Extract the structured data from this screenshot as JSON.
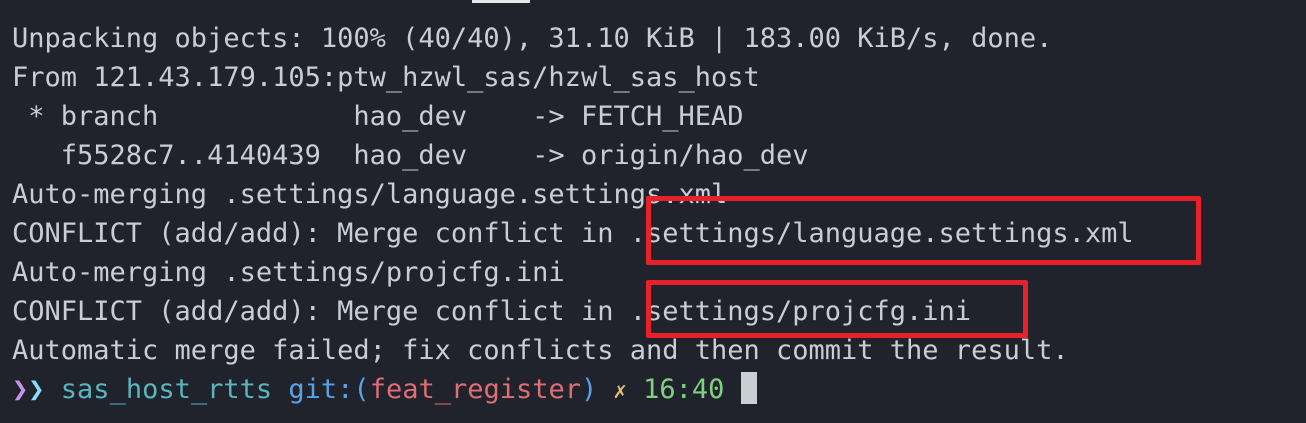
{
  "terminal": {
    "lines": [
      "Unpacking objects: 100% (40/40), 31.10 KiB | 183.00 KiB/s, done.",
      "From 121.43.179.105:ptw_hzwl_sas/hzwl_sas_host",
      " * branch            hao_dev    -> FETCH_HEAD",
      "   f5528c7..4140439  hao_dev    -> origin/hao_dev",
      "Auto-merging .settings/language.settings.xml",
      "CONFLICT (add/add): Merge conflict in .settings/language.settings.xml",
      "Auto-merging .settings/projcfg.ini",
      "CONFLICT (add/add): Merge conflict in .settings/projcfg.ini",
      "Automatic merge failed; fix conflicts and then commit the result."
    ],
    "prompt": {
      "arrow_1": "❯",
      "arrow_2": "❯",
      "directory": "sas_host_rtts",
      "git_label": "git:",
      "paren_open": "(",
      "branch": "feat_register",
      "paren_close": ")",
      "dirty_marker": "✗",
      "time": "16:40"
    }
  },
  "annotations": {
    "highlight_color": "#e8202a"
  }
}
